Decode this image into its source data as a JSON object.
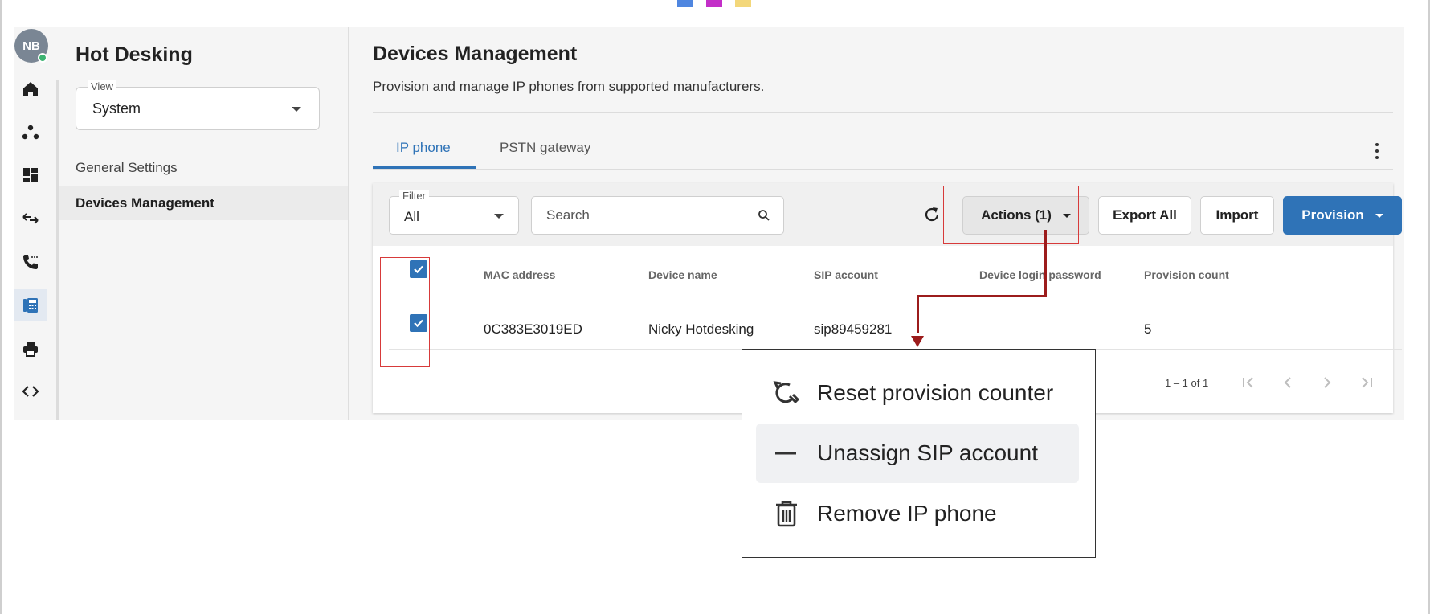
{
  "colors": {
    "accent": "#2f73b7",
    "annotation_box": "#d73a3a",
    "annotation_arrow": "#9c1c1c",
    "top_squares": [
      "#4f86e0",
      "#c32fc8",
      "#f3d77a"
    ]
  },
  "rail": {
    "avatar_initials": "NB",
    "items": [
      {
        "icon": "home-icon"
      },
      {
        "icon": "people-group-icon"
      },
      {
        "icon": "dashboard-icon"
      },
      {
        "icon": "swap-arrows-icon"
      },
      {
        "icon": "phone-call-icon"
      },
      {
        "icon": "desk-phone-icon",
        "active": true
      },
      {
        "icon": "printer-icon"
      },
      {
        "icon": "code-icon"
      }
    ]
  },
  "panel": {
    "title": "Hot Desking",
    "view": {
      "legend": "View",
      "value": "System"
    },
    "nav": [
      {
        "label": "General Settings",
        "active": false
      },
      {
        "label": "Devices Management",
        "active": true
      }
    ]
  },
  "main": {
    "title": "Devices Management",
    "subtitle": "Provision and manage IP phones from supported manufacturers.",
    "tabs": [
      {
        "label": "IP phone",
        "active": true
      },
      {
        "label": "PSTN gateway",
        "active": false
      }
    ]
  },
  "toolbar": {
    "filter": {
      "legend": "Filter",
      "value": "All"
    },
    "search_placeholder": "Search",
    "actions_label": "Actions (1)",
    "export_label": "Export All",
    "import_label": "Import",
    "provision_label": "Provision"
  },
  "table": {
    "columns": [
      "MAC address",
      "Device name",
      "SIP account",
      "Device login password",
      "Provision count"
    ],
    "rows": [
      {
        "selected": true,
        "mac": "0C383E3019ED",
        "device_name": "Nicky Hotdesking",
        "sip_account": "sip89459281",
        "password": "",
        "provision_count": "5"
      }
    ],
    "header_checkbox_checked": true,
    "pagination": "1 – 1 of 1"
  },
  "actions_menu": {
    "items": [
      {
        "label": "Reset provision counter",
        "icon": "reset-counter-icon"
      },
      {
        "label": "Unassign SIP account",
        "icon": "minus-icon",
        "highlighted": true
      },
      {
        "label": "Remove IP phone",
        "icon": "trash-icon"
      }
    ]
  }
}
